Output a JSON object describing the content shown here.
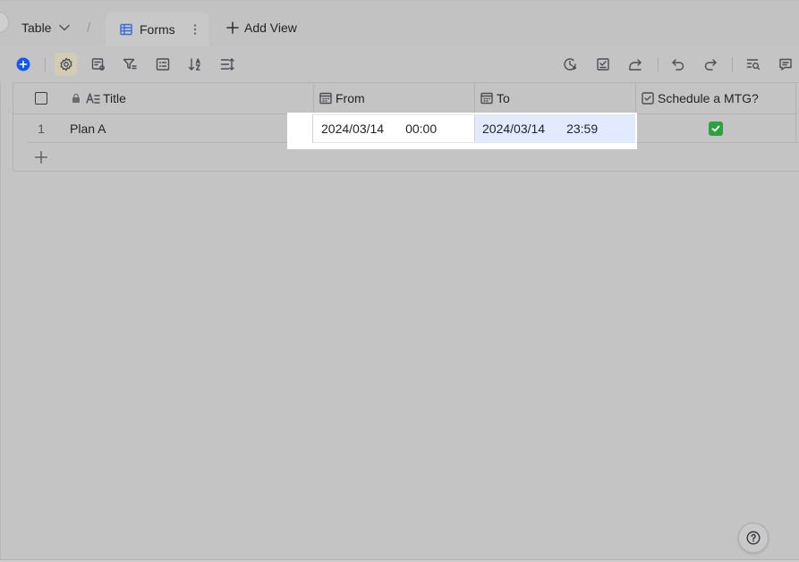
{
  "header": {
    "table_label": "Table",
    "separator": "/",
    "active_tab": "Forms",
    "add_view_label": "Add View"
  },
  "columns": [
    {
      "name": "Title",
      "icon": "text-field-icon",
      "locked": true
    },
    {
      "name": "From",
      "icon": "calendar-icon"
    },
    {
      "name": "To",
      "icon": "calendar-icon"
    },
    {
      "name": "Schedule a MTG?",
      "icon": "checkbox-field-icon"
    }
  ],
  "rows": [
    {
      "index": "1",
      "title": "Plan A",
      "from_date": "2024/03/14",
      "from_time": "00:00",
      "to_date": "2024/03/14",
      "to_time": "23:59",
      "schedule": true
    }
  ],
  "colors": {
    "accent": "#1456f0",
    "check_green": "#2ea043",
    "selected_cell": "#e1eaff",
    "overlay_bg": "#c4c4c4"
  }
}
